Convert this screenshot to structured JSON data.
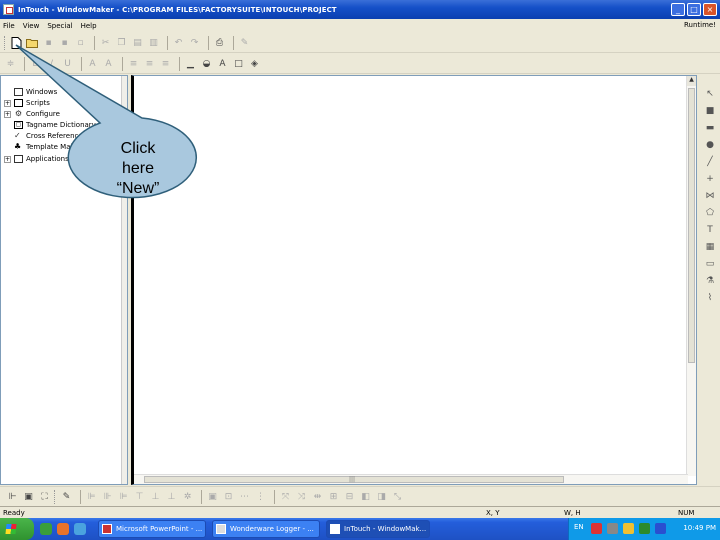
{
  "window": {
    "title": "InTouch - WindowMaker - C:\\PROGRAM FILES\\FACTORYSUITE\\INTOUCH\\PROJECT",
    "minimize": "_",
    "maximize": "□",
    "close": "×"
  },
  "menubar": {
    "items": [
      "File",
      "View",
      "Special",
      "Help"
    ],
    "runtime": "Runtime!"
  },
  "toolbar1": {
    "icons": [
      "new-icon",
      "open-icon",
      "save-icon",
      "save-all-icon",
      "cut-icon",
      "copy-icon",
      "paste-icon",
      "undo-icon",
      "redo-icon",
      "print-icon",
      "wizard-icon"
    ]
  },
  "toolbar2": {
    "icons": [
      "align-icon",
      "line-style-icon",
      "line-color-icon",
      "fill-color-icon",
      "text-color-icon",
      "window-color-icon",
      "fill-icon"
    ]
  },
  "tree": {
    "items": [
      {
        "label": "Windows",
        "icon": "windows-folder-icon",
        "expander": ""
      },
      {
        "label": "Scripts",
        "icon": "scripts-icon",
        "expander": "+"
      },
      {
        "label": "Configure",
        "icon": "configure-icon",
        "expander": "+"
      },
      {
        "label": "Tagname Dictionary",
        "icon": "tagname-dictionary-icon",
        "expander": ""
      },
      {
        "label": "Cross Reference",
        "icon": "cross-reference-icon",
        "expander": ""
      },
      {
        "label": "Template Maker",
        "icon": "template-maker-icon",
        "expander": ""
      },
      {
        "label": "Applications",
        "icon": "applications-icon",
        "expander": "+"
      }
    ]
  },
  "callout": {
    "line1": "Click",
    "line2": "here",
    "line3": "“New”",
    "fill": "#a9c8de",
    "stroke": "#2f5f7a"
  },
  "toolbox": {
    "tools": [
      "select-icon",
      "rectangle-icon",
      "rounded-rectangle-icon",
      "ellipse-icon",
      "line-icon",
      "hv-line-icon",
      "polyline-icon",
      "polygon-icon",
      "text-icon",
      "bitmap-icon",
      "button-icon",
      "wizard-icon",
      "trend-icon"
    ]
  },
  "statusbar": {
    "ready": "Ready",
    "xy": "X, Y",
    "wh": "W, H",
    "num": "NUM"
  },
  "taskbar": {
    "tasks": [
      "Microsoft PowerPoint - ...",
      "Wonderware Logger - ...",
      "InTouch - WindowMak..."
    ],
    "lang": "EN",
    "clock": "10:49 PM"
  },
  "colors": {
    "titlebar": "#1550c8",
    "taskbar": "#245edb",
    "tray": "#0f9ae8"
  }
}
